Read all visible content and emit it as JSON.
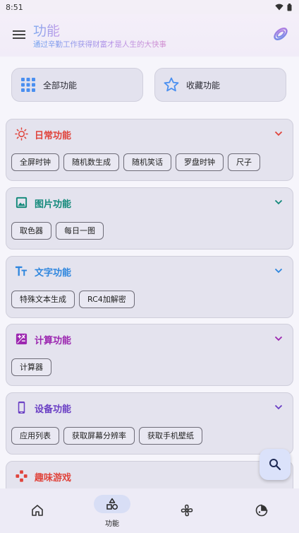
{
  "status": {
    "time": "8:51"
  },
  "app": {
    "title": "功能",
    "subtitle": "通过辛勤工作获得财富才是人生的大快事"
  },
  "quick": {
    "all_label": "全部功能",
    "fav_label": "收藏功能"
  },
  "categories": [
    {
      "title": "日常功能",
      "color": "#e0443c",
      "icon": "sun-icon",
      "items": [
        "全屏时钟",
        "随机数生成",
        "随机笑话",
        "罗盘时钟",
        "尺子"
      ]
    },
    {
      "title": "图片功能",
      "color": "#12897a",
      "icon": "image-icon",
      "items": [
        "取色器",
        "每日一图"
      ]
    },
    {
      "title": "文字功能",
      "color": "#2e86de",
      "icon": "text-size-icon",
      "items": [
        "特殊文本生成",
        "RC4加解密"
      ]
    },
    {
      "title": "计算功能",
      "color": "#9c27b0",
      "icon": "calculate-icon",
      "items": [
        "计算器"
      ]
    },
    {
      "title": "设备功能",
      "color": "#6a3fc4",
      "icon": "phone-icon",
      "items": [
        "应用列表",
        "获取屏幕分辨率",
        "获取手机壁纸"
      ]
    },
    {
      "title": "趣味游戏",
      "color": "#e0443c",
      "icon": "gamepad-icon",
      "items": []
    }
  ],
  "nav": {
    "items": [
      {
        "icon": "home-icon",
        "label": ""
      },
      {
        "icon": "category-icon",
        "label": "功能"
      },
      {
        "icon": "fan-icon",
        "label": ""
      },
      {
        "icon": "palette-icon",
        "label": ""
      }
    ]
  }
}
